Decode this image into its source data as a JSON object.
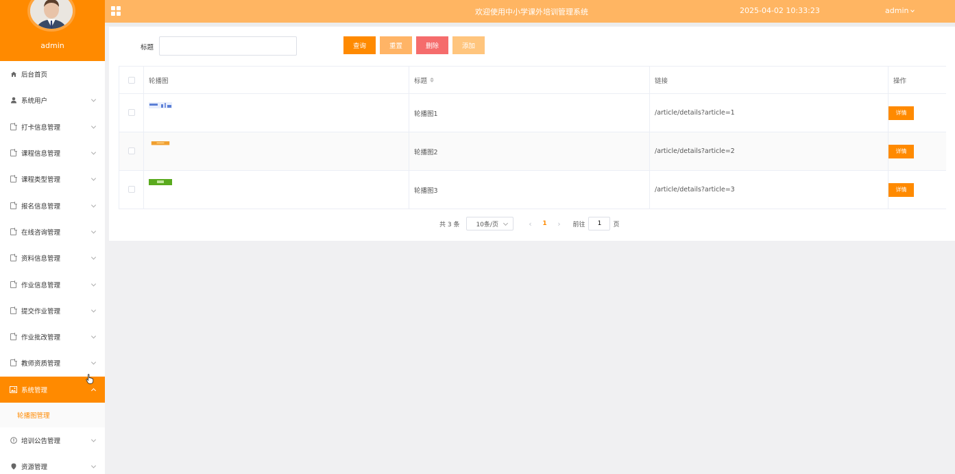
{
  "sidebar": {
    "username": "admin",
    "menu": [
      {
        "label": "后台首页",
        "icon": "home-icon",
        "has_chevron": false,
        "active": false
      },
      {
        "label": "系统用户",
        "icon": "user-icon",
        "has_chevron": true,
        "active": false
      },
      {
        "label": "打卡信息管理",
        "icon": "document-icon",
        "has_chevron": true,
        "active": false
      },
      {
        "label": "课程信息管理",
        "icon": "document-icon",
        "has_chevron": true,
        "active": false
      },
      {
        "label": "课程类型管理",
        "icon": "document-icon",
        "has_chevron": true,
        "active": false
      },
      {
        "label": "报名信息管理",
        "icon": "document-icon",
        "has_chevron": true,
        "active": false
      },
      {
        "label": "在线咨询管理",
        "icon": "document-icon",
        "has_chevron": true,
        "active": false
      },
      {
        "label": "资料信息管理",
        "icon": "document-icon",
        "has_chevron": true,
        "active": false
      },
      {
        "label": "作业信息管理",
        "icon": "document-icon",
        "has_chevron": true,
        "active": false
      },
      {
        "label": "提交作业管理",
        "icon": "document-icon",
        "has_chevron": true,
        "active": false
      },
      {
        "label": "作业批改管理",
        "icon": "document-icon",
        "has_chevron": true,
        "active": false
      },
      {
        "label": "教师资质管理",
        "icon": "document-icon",
        "has_chevron": true,
        "active": false
      },
      {
        "label": "系统管理",
        "icon": "picture-icon",
        "has_chevron": true,
        "active": true
      },
      {
        "label": "培训公告管理",
        "icon": "info-icon",
        "has_chevron": true,
        "active": false
      },
      {
        "label": "资源管理",
        "icon": "location-icon",
        "has_chevron": true,
        "active": false
      }
    ],
    "submenu": {
      "label": "轮播图管理"
    }
  },
  "topbar": {
    "title": "欢迎使用中小学课外培训管理系统",
    "datetime": "2025-04-02 10:33:23",
    "user": "admin"
  },
  "search": {
    "label": "标题",
    "value": "",
    "placeholder": ""
  },
  "buttons": {
    "query": "查询",
    "reset": "重置",
    "delete": "删除",
    "add": "添加"
  },
  "table": {
    "columns": [
      "轮播图",
      "标题",
      "链接",
      "操作"
    ],
    "rows": [
      {
        "title": "轮播图1",
        "link": "/article/details?article=1",
        "action": "详情",
        "thumb_color": "#5b7fd6"
      },
      {
        "title": "轮播图2",
        "link": "/article/details?article=2",
        "action": "详情",
        "thumb_color": "#f0a030"
      },
      {
        "title": "轮播图3",
        "link": "/article/details?article=3",
        "action": "详情",
        "thumb_color": "#5aaa1e"
      }
    ]
  },
  "pagination": {
    "total": "共 3 条",
    "page_size": "10条/页",
    "current": "1",
    "goto_label": "前往",
    "goto_value": "1",
    "unit": "页"
  }
}
